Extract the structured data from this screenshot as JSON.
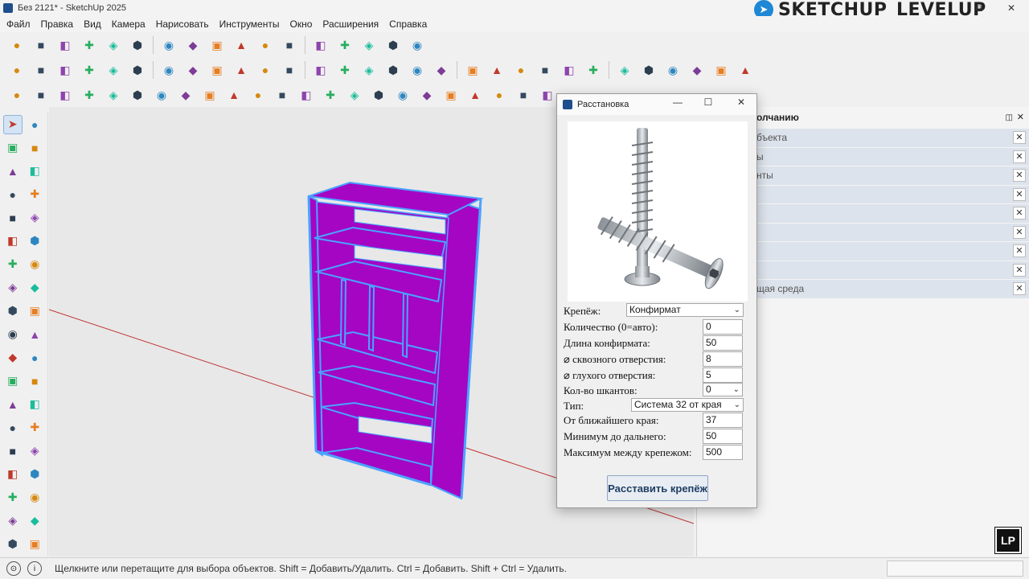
{
  "window": {
    "title": "Без 2121* - SketchUp 2025",
    "brand": "SKETCHUP_LEVELUP",
    "controls": [
      "⧉",
      "—",
      "✕"
    ]
  },
  "menu": [
    "Файл",
    "Правка",
    "Вид",
    "Камера",
    "Нарисовать",
    "Инструменты",
    "Окно",
    "Расширения",
    "Справка"
  ],
  "toolbar1": [
    "component-move-icon",
    "component-icon",
    "vertical-bar-icon",
    "arrows-updown-icon",
    "arrows-icon",
    "resize-icon",
    "hourglass-icon",
    "undo-curve-icon",
    "redo-curve-icon",
    "pdf-icon",
    "box-icon",
    "box-gear-icon",
    "panel-icon",
    "hand-icon",
    "gear-icon",
    "ocl-icon",
    "clock-icon"
  ],
  "toolbar2": [
    "tape-icon",
    "notes-icon",
    "door-icon",
    "cube-icon",
    "cube-outline-icon",
    "house-icon",
    "door-frame-icon",
    "door-open-icon",
    "shape-icon",
    "shape-corner-icon",
    "box-view-1-icon",
    "box-view-2-icon",
    "box-view-3-icon",
    "box-view-4-icon",
    "box-view-5-icon",
    "box-view-6-icon",
    "box-view-7-icon",
    "box-view-8-icon",
    "box-view-9-icon",
    "component-edit-icon",
    "plus-circle-icon",
    "shield-icon",
    "doc-icon",
    "checker-icon",
    "cloud-icon",
    "settings-icon",
    "comment-icon",
    "info-icon",
    "cart-icon",
    "user-icon"
  ],
  "toolbar3": [
    "pencil-icon",
    "plank-icon",
    "stack-icon",
    "stack-selected-icon",
    "box-3d-icon",
    "coil-icon",
    "red-arrow-icon",
    "green-arrow-icon",
    "blue-arrow-icon",
    "axes-icon",
    "table-icon",
    "striped-panel-icon",
    "knob-icon",
    "hinge-icon",
    "red-tool-icon",
    "drill-icon",
    "board-icon",
    "gear-small-icon",
    "magnet-icon",
    "expand-icon",
    "swap-icon",
    "glue-icon",
    "percent-icon"
  ],
  "leftpal": [
    [
      "select-arrow-icon",
      "lasso-icon"
    ],
    [
      "paint-bucket-icon",
      "eraser-icon"
    ],
    [
      "component-group-icon",
      "eraser-outline-icon"
    ],
    [
      "line-pencil-icon",
      "freehand-icon"
    ],
    [
      "rectangle-icon",
      "rotated-rect-icon"
    ],
    [
      "circle-icon",
      "polygon-icon"
    ],
    [
      "arc-icon",
      "arc-2-icon"
    ],
    [
      "arc-3-icon",
      "arc-4-icon"
    ],
    [
      "move-icon",
      "push-pull-icon"
    ],
    [
      "rotate-icon",
      "follow-me-icon"
    ],
    [
      "scale-icon",
      "offset-icon"
    ],
    [
      "explode-icon",
      "triangle-icon"
    ],
    [
      "tape-measure-icon",
      "dimension-icon"
    ],
    [
      "protractor-icon",
      "text-icon"
    ],
    [
      "axes-tool-icon",
      "3d-text-icon"
    ],
    [
      "section-icon",
      "walk-icon"
    ],
    [
      "zoom-icon",
      "zoom-window-icon"
    ],
    [
      "zoom-extents-icon",
      "previous-view-icon"
    ],
    [
      "position-camera-icon",
      "walk-person-icon"
    ]
  ],
  "tray": {
    "title": "олчанию",
    "items": [
      "бъекта",
      "ы",
      "нты",
      "",
      "",
      "",
      "",
      "",
      "щая среда"
    ]
  },
  "dialog": {
    "title": "Расстановка",
    "fields": [
      {
        "label": "Крепёж:",
        "value": "Конфирмат",
        "kind": "select"
      },
      {
        "label": "Количество (0=авто):",
        "value": "0",
        "kind": "input"
      },
      {
        "label": "Длина конфирмата:",
        "value": "50",
        "kind": "input"
      },
      {
        "label": "⌀ сквозного отверстия:",
        "value": "8",
        "kind": "input"
      },
      {
        "label": "⌀ глухого отверстия:",
        "value": "5",
        "kind": "input"
      },
      {
        "label": "Кол-во шкантов:",
        "value": "0",
        "kind": "select"
      },
      {
        "label": "Тип:",
        "value": "Система 32 от края",
        "kind": "select"
      },
      {
        "label": "От ближайшего края:",
        "value": "37",
        "kind": "input"
      },
      {
        "label": "Минимум до дальнего:",
        "value": "50",
        "kind": "input"
      },
      {
        "label": "Максимум между крепежом:",
        "value": "500",
        "kind": "input"
      }
    ],
    "button": "Расставить крепёж"
  },
  "status": {
    "message": "Щелкните или перетащите для выбора объектов. Shift = Добавить/Удалить. Ctrl = Добавить. Shift + Ctrl = Удалить.",
    "logo": "LP"
  },
  "colors": {
    "shelf_fill": "#a406c4",
    "shelf_edge": "#4aa3ff",
    "red_axis": "#c03030"
  }
}
